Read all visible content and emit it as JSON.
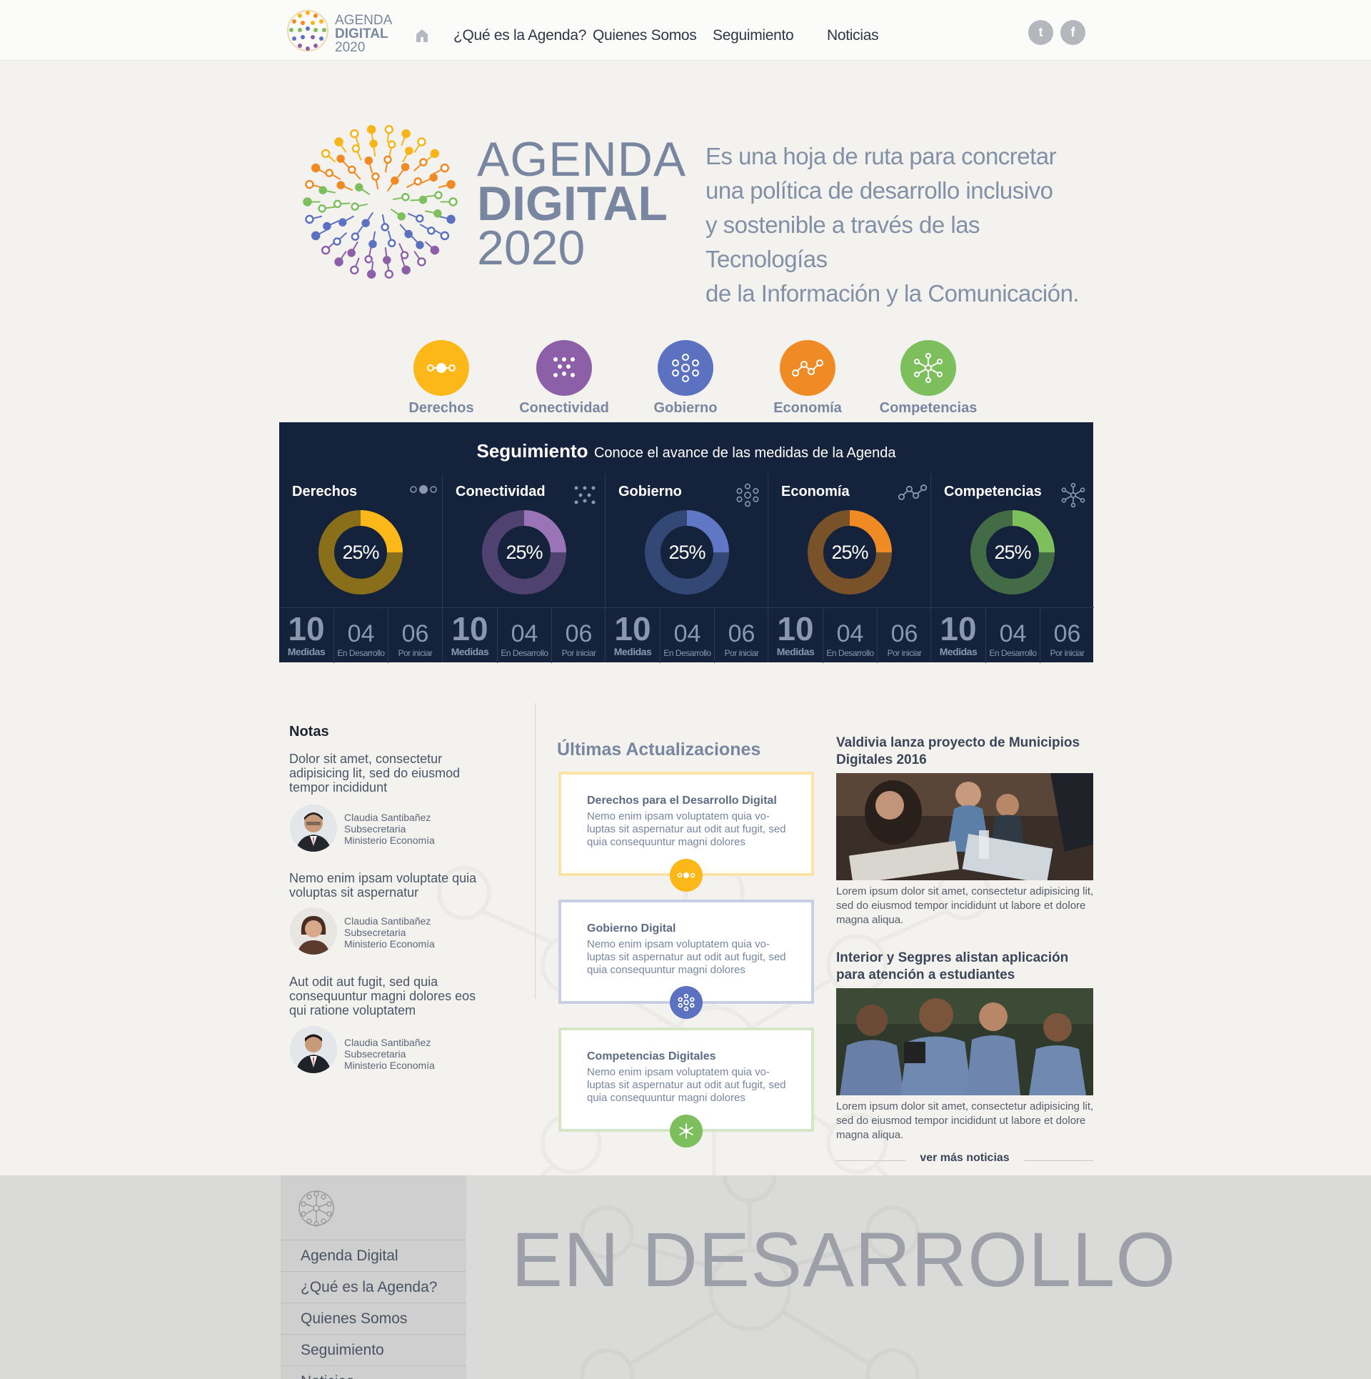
{
  "header": {
    "logo": {
      "line1": "AGENDA",
      "line2": "DIGITAL",
      "line3": "2020"
    },
    "nav": [
      {
        "label": "¿Qué es la Agenda?"
      },
      {
        "label": "Quienes Somos"
      },
      {
        "label": "Seguimiento"
      },
      {
        "label": "Noticias"
      }
    ],
    "social": {
      "twitter": "t",
      "facebook": "f"
    }
  },
  "hero": {
    "title_line1": "AGENDA",
    "title_line2": "DIGITAL",
    "title_line3": "2020",
    "description": [
      "Es una hoja de ruta para concretar",
      "una política de desarrollo inclusivo",
      "y sostenible a través de las Tecnologías",
      "de la Información y la Comunicación."
    ]
  },
  "categories": [
    {
      "label": "Derechos",
      "color": "#fbb818"
    },
    {
      "label": "Conectividad",
      "color": "#8d5fa8"
    },
    {
      "label": "Gobierno",
      "color": "#5c72c0"
    },
    {
      "label": "Economía",
      "color": "#f08a25"
    },
    {
      "label": "Competencias",
      "color": "#7cbf5c"
    }
  ],
  "seguimiento": {
    "title": "Seguimiento",
    "subtitle": "Conoce el avance de las medidas de la Agenda",
    "columns": [
      {
        "name": "Derechos",
        "percent_label": "25%",
        "progress": 0.25,
        "color": "#fbb818",
        "track": "#8a6f1b",
        "medidas": "10",
        "medidas_label": "Medidas",
        "desarrollo": "04",
        "desarrollo_label": "En Desarrollo",
        "iniciar": "06",
        "iniciar_label": "Por iniciar"
      },
      {
        "name": "Conectividad",
        "percent_label": "25%",
        "progress": 0.25,
        "color": "#9a74b6",
        "track": "#4f4270",
        "medidas": "10",
        "medidas_label": "Medidas",
        "desarrollo": "04",
        "desarrollo_label": "En Desarrollo",
        "iniciar": "06",
        "iniciar_label": "Por iniciar"
      },
      {
        "name": "Gobierno",
        "percent_label": "25%",
        "progress": 0.25,
        "color": "#6077c6",
        "track": "#334875",
        "medidas": "10",
        "medidas_label": "Medidas",
        "desarrollo": "04",
        "desarrollo_label": "En Desarrollo",
        "iniciar": "06",
        "iniciar_label": "Por iniciar"
      },
      {
        "name": "Economía",
        "percent_label": "25%",
        "progress": 0.25,
        "color": "#f08a25",
        "track": "#7a5229",
        "medidas": "10",
        "medidas_label": "Medidas",
        "desarrollo": "04",
        "desarrollo_label": "En Desarrollo",
        "iniciar": "06",
        "iniciar_label": "Por iniciar"
      },
      {
        "name": "Competencias",
        "percent_label": "25%",
        "progress": 0.25,
        "color": "#7cbf5c",
        "track": "#436b46",
        "medidas": "10",
        "medidas_label": "Medidas",
        "desarrollo": "04",
        "desarrollo_label": "En Desarrollo",
        "iniciar": "06",
        "iniciar_label": "Por iniciar"
      }
    ]
  },
  "notas": {
    "title": "Notas",
    "items": [
      {
        "quote": "Dolor sit amet, consectetur adipisicing lit, sed do eiusmod tempor incididunt",
        "author": "Claudia Santibañez",
        "role": "Subsecretaria",
        "org": "Ministerio Economía"
      },
      {
        "quote": "Nemo enim ipsam voluptate quia voluptas sit aspernatur",
        "author": "Claudia Santibañez",
        "role": "Subsecretaria",
        "org": "Ministerio Economía"
      },
      {
        "quote": "Aut odit aut fugit, sed quia consequuntur magni dolores eos qui ratione voluptatem",
        "author": "Claudia Santibañez",
        "role": "Subsecretaria",
        "org": "Ministerio Economía"
      }
    ]
  },
  "actualizaciones": {
    "title": "Últimas Actualizaciones",
    "items": [
      {
        "title": "Derechos para el Desarrollo Digital",
        "text": "Nemo enim ipsam voluptatem quia vo-luptas sit aspernatur aut odit aut fugit, sed quia consequuntur magni dolores",
        "border": "#fbe3a6",
        "badge": "#fbb818"
      },
      {
        "title": "Gobierno Digital",
        "text": "Nemo enim ipsam voluptatem quia vo-luptas sit aspernatur aut odit aut fugit, sed quia consequuntur magni dolores",
        "border": "#c9cfe3",
        "badge": "#5c72c0"
      },
      {
        "title": "Competencias Digitales",
        "text": "Nemo enim ipsam voluptatem quia vo-luptas sit aspernatur aut odit aut fugit, sed quia consequuntur magni dolores",
        "border": "#d3e6c8",
        "badge": "#7cbf5c"
      }
    ]
  },
  "noticias": {
    "items": [
      {
        "title": "Valdivia lanza proyecto de Municipios Digitales 2016",
        "text": "Lorem ipsum dolor sit amet, consectetur adipisicing lit, sed do eiusmod tempor incididunt ut labore et dolore magna aliqua."
      },
      {
        "title": "Interior y Segpres alistan aplicación para atención a estudiantes",
        "text": "Lorem ipsum dolor sit amet, consectetur adipisicing lit, sed do eiusmod tempor incididunt ut labore et dolore magna aliqua."
      }
    ],
    "more": "ver más noticias"
  },
  "footer": {
    "nav": [
      {
        "label": "Agenda Digital"
      },
      {
        "label": "¿Qué es la Agenda?"
      },
      {
        "label": "Quienes Somos"
      },
      {
        "label": "Seguimiento"
      },
      {
        "label": "Noticias"
      }
    ],
    "banner": "EN DESARROLLO"
  }
}
